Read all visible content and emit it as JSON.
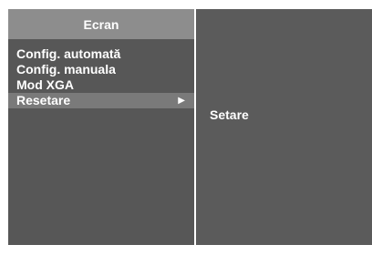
{
  "menu": {
    "title": "Ecran",
    "items": [
      {
        "label": "Config. automată"
      },
      {
        "label": "Config. manuala"
      },
      {
        "label": "Mod XGA"
      },
      {
        "label": "Resetare",
        "selected": true
      }
    ]
  },
  "submenu": {
    "items": [
      {
        "label": "Setare"
      }
    ]
  },
  "icons": {
    "submenu_arrow": "right-triangle-arrow"
  },
  "colors": {
    "title_bar": "#8d8d8d",
    "panel": "#575757",
    "selected_row": "#7a7a7a",
    "text": "#ffffff"
  }
}
